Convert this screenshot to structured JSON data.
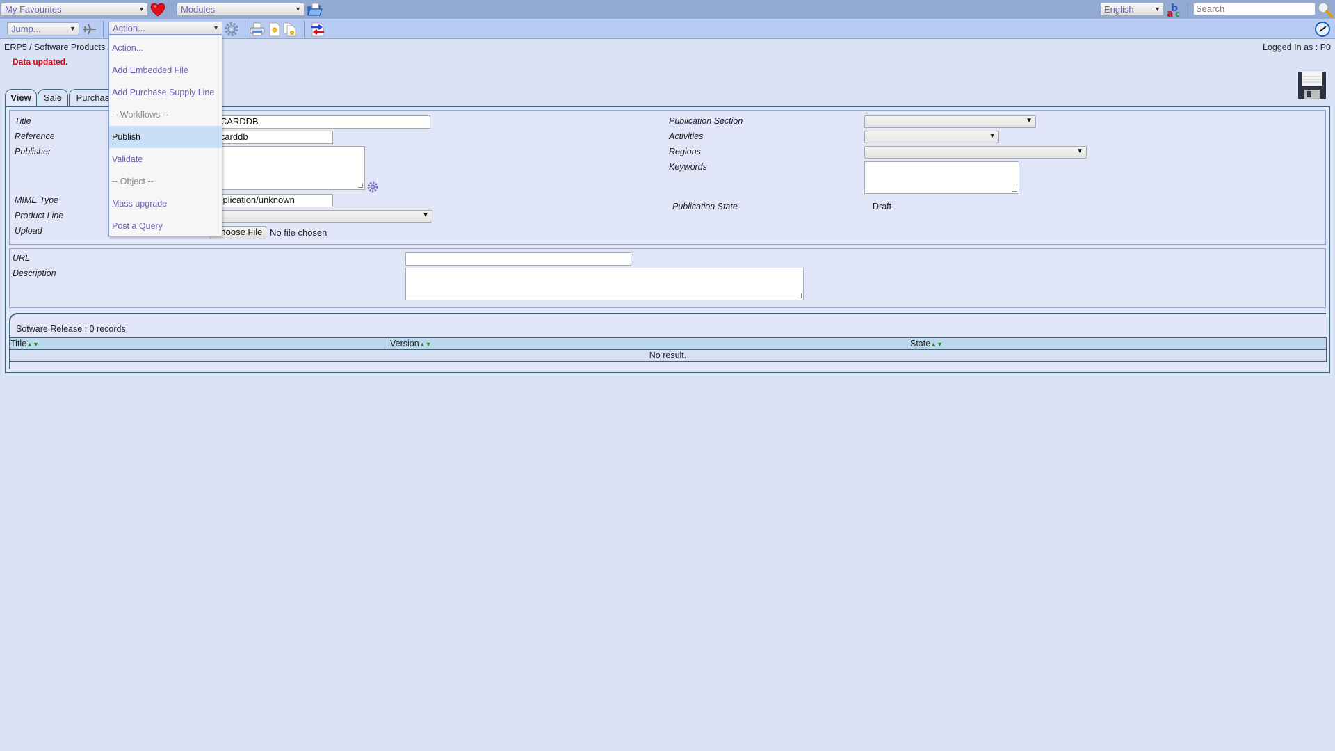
{
  "topbar": {
    "favourites": "My Favourites",
    "modules": "Modules",
    "language": "English",
    "search_placeholder": "Search"
  },
  "toolbar": {
    "jump": "Jump...",
    "action": "Action..."
  },
  "breadcrumb": "ERP5 / Software Products /",
  "logged_in": "Logged In as : P0",
  "message": "Data updated.",
  "tabs": [
    {
      "label": "View",
      "active": true
    },
    {
      "label": "Sale",
      "active": false
    },
    {
      "label": "Purchase",
      "active": false
    }
  ],
  "action_menu": {
    "items": [
      {
        "label": "Action...",
        "type": "item"
      },
      {
        "label": "Add Embedded File",
        "type": "item"
      },
      {
        "label": "Add Purchase Supply Line",
        "type": "item"
      },
      {
        "label": "-- Workflows --",
        "type": "group"
      },
      {
        "label": "Publish",
        "type": "item",
        "highlighted": true
      },
      {
        "label": "Validate",
        "type": "item"
      },
      {
        "label": "-- Object --",
        "type": "group"
      },
      {
        "label": "Mass upgrade",
        "type": "item"
      },
      {
        "label": "Post a Query",
        "type": "item"
      }
    ]
  },
  "form": {
    "left": {
      "title_label": "Title",
      "title_value": "MCARDDB",
      "reference_label": "Reference",
      "reference_value": "mcarddb",
      "publisher_label": "Publisher",
      "publisher_value": "",
      "mime_label": "MIME Type",
      "mime_value": "application/unknown",
      "product_line_label": "Product Line",
      "product_line_value": "",
      "upload_label": "Upload",
      "choose_file": "Choose File",
      "no_file": "No file chosen"
    },
    "right": {
      "publication_section_label": "Publication Section",
      "activities_label": "Activities",
      "regions_label": "Regions",
      "keywords_label": "Keywords",
      "publication_state_label": "Publication State",
      "publication_state_value": "Draft"
    },
    "bottom": {
      "url_label": "URL",
      "url_value": "",
      "description_label": "Description",
      "description_value": ""
    }
  },
  "listbox": {
    "title": "Sotware Release :  0 records",
    "columns": [
      "Title",
      "Version",
      "State"
    ],
    "empty_text": "No result."
  }
}
